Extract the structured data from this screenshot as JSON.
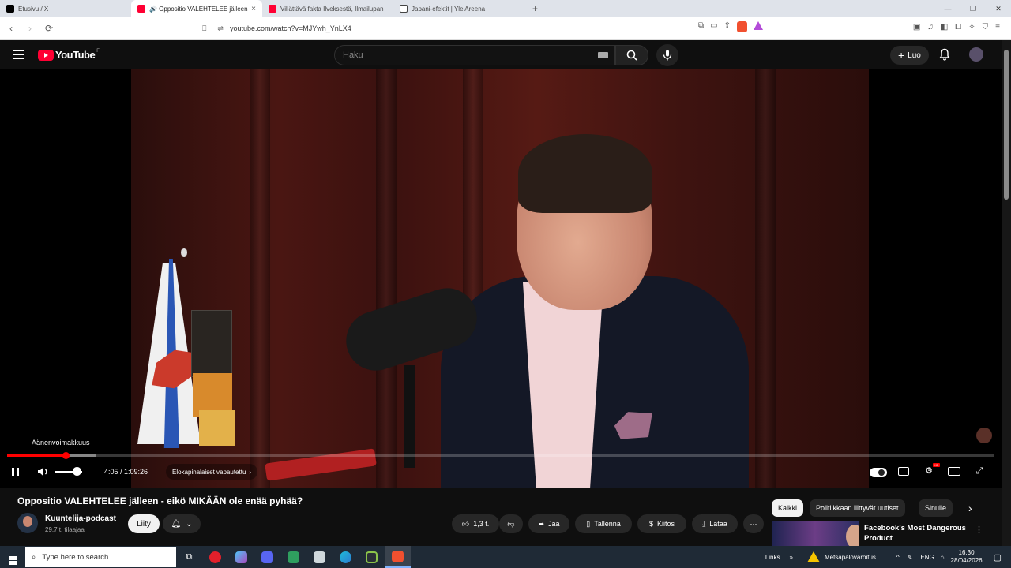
{
  "browser": {
    "tabs": [
      {
        "label": "Etusivu / X",
        "color": "#000000"
      },
      {
        "label": "🔊 Oppositio VALEHTELEE jälleen",
        "color": "#ff0033",
        "active": true
      },
      {
        "label": "Villättävä fakta Ilveksestä, Ilmailupan",
        "color": "#ff0033"
      },
      {
        "label": "Japani-efektit | Yle Areena",
        "color": "#444444"
      }
    ],
    "tab_close": "×",
    "new_tab": "+",
    "window_controls": [
      "—",
      "❐",
      "✕"
    ],
    "url": "youtube.com/watch?v=MJYwh_YnLX4"
  },
  "youtube": {
    "logo_text": "YouTube",
    "region": "FI",
    "search_placeholder": "Haku",
    "create_label": "Luo",
    "create_plus": "+"
  },
  "player": {
    "volume_tooltip": "Äänenvoimakkuus",
    "time": "4:05 / 1:09:26",
    "chapter": "Elokapinalaiset vapautettu",
    "chapter_arrow": "›",
    "progress": 0.059,
    "buffered": 0.09,
    "hd_badge": "HD"
  },
  "video": {
    "title": "Oppositio VALEHTELEE jälleen - eikö MIKÄÄN ole enää pyhää?",
    "channel": "Kuuntelija-podcast",
    "subscribers": "29,7 t. tilaajaa",
    "join_label": "Liity",
    "like_count": "1,3 t.",
    "share_label": "Jaa",
    "save_label": "Tallenna",
    "thanks_label": "Kiitos",
    "download_label": "Lataa",
    "more": "···"
  },
  "sidebar": {
    "chips": [
      "Kaikki",
      "Politiikkaan liittyvät uutiset",
      "Sinulle"
    ],
    "next_arrow": "›",
    "rec_title": "Facebook's Most Dangerous Product",
    "rec_more": "⋮"
  },
  "taskbar": {
    "search_placeholder": "Type here to search",
    "links_label": "Links",
    "links_arrows": "»",
    "alert": "Metsäpalovaroitus",
    "lang": "ENG",
    "time": "16.30",
    "date": "28/04/2026"
  }
}
